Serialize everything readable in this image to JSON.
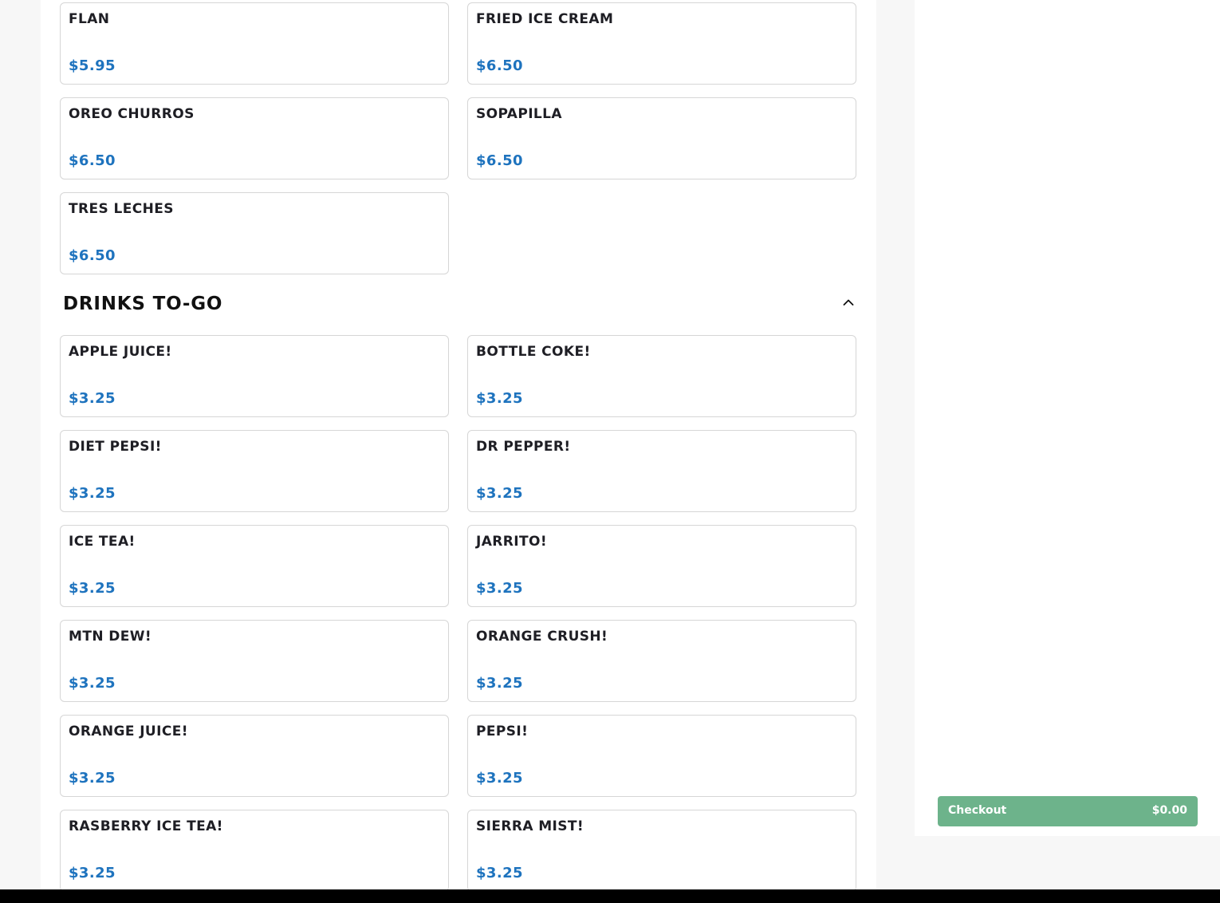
{
  "desserts": {
    "items": [
      {
        "name": "FLAN",
        "price": "$5.95"
      },
      {
        "name": "FRIED ICE CREAM",
        "price": "$6.50"
      },
      {
        "name": "OREO CHURROS",
        "price": "$6.50"
      },
      {
        "name": "SOPAPILLA",
        "price": "$6.50"
      },
      {
        "name": "TRES LECHES",
        "price": "$6.50"
      }
    ]
  },
  "drinks": {
    "title": "DRINKS TO-GO",
    "collapse_icon": "chevron-up-icon",
    "items": [
      {
        "name": "APPLE JUICE!",
        "price": "$3.25"
      },
      {
        "name": "BOTTLE COKE!",
        "price": "$3.25"
      },
      {
        "name": "DIET PEPSI!",
        "price": "$3.25"
      },
      {
        "name": "DR PEPPER!",
        "price": "$3.25"
      },
      {
        "name": "ICE TEA!",
        "price": "$3.25"
      },
      {
        "name": "JARRITO!",
        "price": "$3.25"
      },
      {
        "name": "MTN DEW!",
        "price": "$3.25"
      },
      {
        "name": "ORANGE CRUSH!",
        "price": "$3.25"
      },
      {
        "name": "ORANGE JUICE!",
        "price": "$3.25"
      },
      {
        "name": "PEPSI!",
        "price": "$3.25"
      },
      {
        "name": "RASBERRY ICE TEA!",
        "price": "$3.25"
      },
      {
        "name": "SIERRA MIST!",
        "price": "$3.25"
      }
    ]
  },
  "cart": {
    "checkout_label": "Checkout",
    "total": "$0.00"
  },
  "colors": {
    "price": "#1e73be",
    "checkout_bg": "#6db38b",
    "card_border": "#d6d6d6"
  }
}
